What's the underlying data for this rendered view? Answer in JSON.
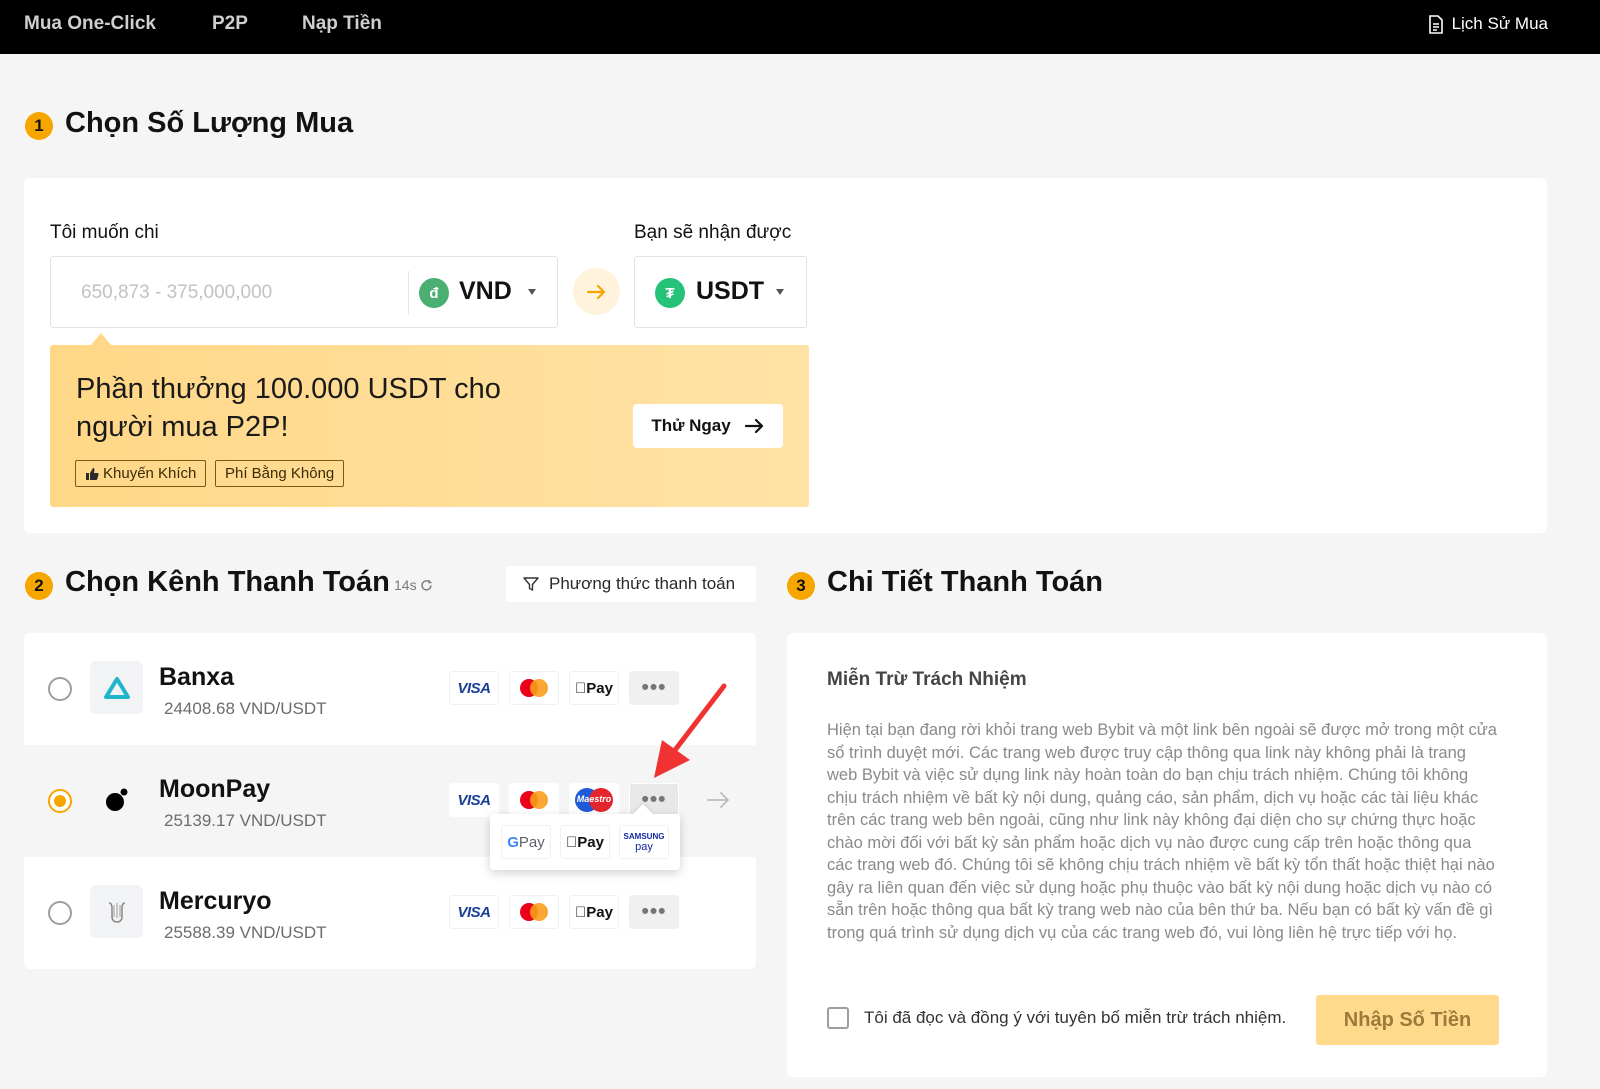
{
  "nav": {
    "items": [
      "Mua One-Click",
      "P2P",
      "Nạp Tiền"
    ],
    "history_label": "Lịch Sử Mua"
  },
  "step1": {
    "number": "1",
    "title": "Chọn Số Lượng Mua",
    "spend_label": "Tôi muốn chi",
    "spend_placeholder": "650,873 - 375,000,000",
    "spend_currency": "VND",
    "spend_currency_symbol": "đ",
    "receive_label": "Bạn sẽ nhận được",
    "receive_currency": "USDT",
    "receive_currency_symbol": "₮"
  },
  "promo": {
    "text": "Phần thưởng 100.000 USDT cho người mua P2P!",
    "tags": [
      "Khuyến Khích",
      "Phí Bằng Không"
    ],
    "button": "Thử Ngay"
  },
  "step2": {
    "number": "2",
    "title": "Chọn Kênh Thanh Toán",
    "timer": "14s",
    "filter_label": "Phương thức thanh toán",
    "providers": [
      {
        "name": "Banxa",
        "rate": "24408.68 VND/USDT",
        "selected": false,
        "methods": [
          "VISA",
          "Mastercard",
          "Apple Pay"
        ]
      },
      {
        "name": "MoonPay",
        "rate": "25139.17 VND/USDT",
        "selected": true,
        "methods": [
          "VISA",
          "Mastercard",
          "Maestro"
        ]
      },
      {
        "name": "Mercuryo",
        "rate": "25588.39 VND/USDT",
        "selected": false,
        "methods": [
          "VISA",
          "Mastercard",
          "Apple Pay"
        ]
      }
    ],
    "more_popup": [
      "Google Pay",
      "Apple Pay",
      "Samsung Pay"
    ],
    "pay_brand": {
      "visa": "VISA",
      "apple": "Pay",
      "google_g": "G",
      "google": "Pay",
      "maestro": "Maestro",
      "samsung_top": "SAMSUNG",
      "samsung_bottom": "pay"
    }
  },
  "step3": {
    "number": "3",
    "title": "Chi Tiết Thanh Toán",
    "disclaimer_title": "Miễn Trừ Trách Nhiệm",
    "disclaimer_body": "Hiện tại bạn đang rời khỏi trang web Bybit và một link bên ngoài sẽ được mở trong một cửa sổ trình duyệt mới. Các trang web được truy cập thông qua link này không phải là trang web Bybit và việc sử dụng link này hoàn toàn do bạn chịu trách nhiệm. Chúng tôi không chịu trách nhiệm về bất kỳ nội dung, quảng cáo, sản phẩm, dịch vụ hoặc các tài liệu khác trên các trang web bên ngoài, cũng như link này không đại diện cho sự chứng thực hoặc chào mời đối với bất kỳ sản phẩm hoặc dịch vụ nào được cung cấp trên hoặc thông qua các trang web đó. Chúng tôi sẽ không chịu trách nhiệm về bất kỳ tổn thất hoặc thiệt hại nào gây ra liên quan đến việc sử dụng hoặc phụ thuộc vào bất kỳ nội dung hoặc dịch vụ nào có sẵn trên hoặc thông qua bất kỳ trang web nào của bên thứ ba. Nếu bạn có bất kỳ vấn đề gì trong quá trình sử dụng dịch vụ của các trang web đó, vui lòng liên hệ trực tiếp với họ.",
    "agree_text": "Tôi đã đọc và đồng ý với tuyên bố miễn trừ trách nhiệm.",
    "enter_button": "Nhập Số Tiền"
  },
  "colors": {
    "accent": "#f7a600",
    "nav_bg": "#000000",
    "annotation_arrow": "#f03232",
    "vnd_green": "#4caf72",
    "usdt_green": "#26c27a"
  }
}
